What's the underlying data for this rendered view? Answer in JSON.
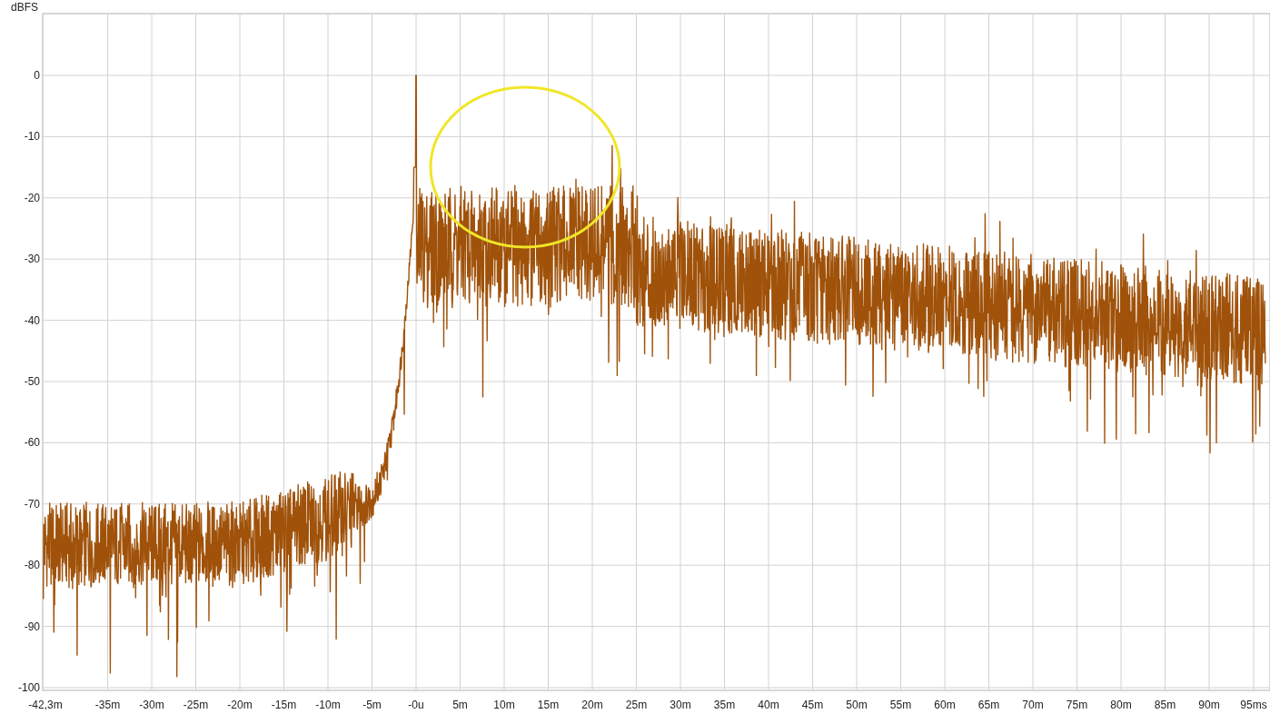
{
  "chart": {
    "ylabel": "dBFS",
    "yticks": [
      "0",
      "-10",
      "-20",
      "-30",
      "-40",
      "-50",
      "-60",
      "-70",
      "-80",
      "-90",
      "-100"
    ],
    "xticks": [
      "-42,3m",
      "-35m",
      "-30m",
      "-25m",
      "-20m",
      "-15m",
      "-10m",
      "-5m",
      "-0u",
      "5m",
      "10m",
      "15m",
      "20m",
      "25m",
      "30m",
      "35m",
      "40m",
      "45m",
      "50m",
      "55m",
      "60m",
      "65m",
      "70m",
      "75m",
      "80m",
      "85m",
      "90m",
      "95ms"
    ]
  }
}
